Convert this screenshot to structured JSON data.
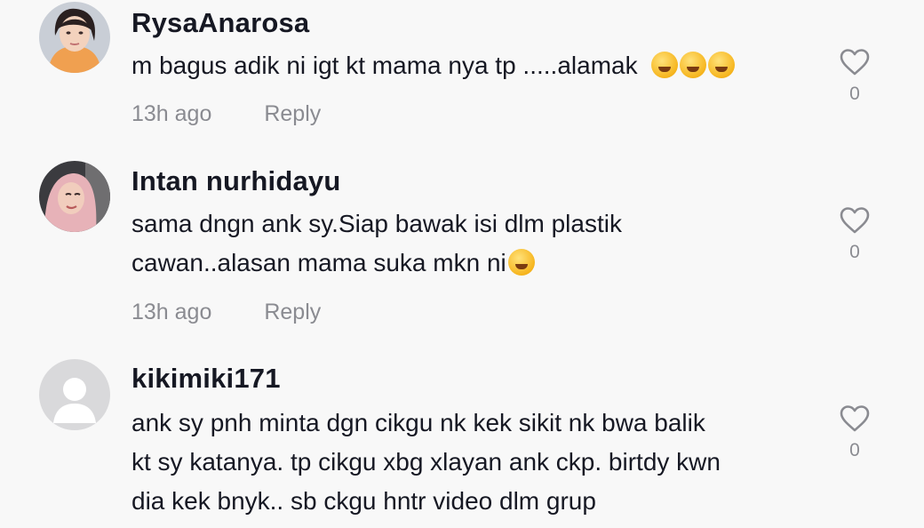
{
  "comments": [
    {
      "username": "RysaAnarosa",
      "lines": [
        "m bagus adik ni igt kt mama nya tp .....alamak"
      ],
      "emojis": [
        "rofl-emoji",
        "rofl-emoji",
        "hand-over-mouth-emoji"
      ],
      "time": "13h ago",
      "reply_label": "Reply",
      "likes": "0",
      "avatar": "woman-photo-avatar"
    },
    {
      "username": "Intan nurhidayu",
      "lines": [
        "sama dngn ank sy.Siap bawak isi dlm plastik",
        "cawan..alasan mama suka mkn ni"
      ],
      "emojis": [
        "joy-emoji"
      ],
      "time": "13h ago",
      "reply_label": "Reply",
      "likes": "0",
      "avatar": "hijab-woman-photo-avatar"
    },
    {
      "username": "kikimiki171",
      "lines": [
        "ank sy pnh minta dgn cikgu nk kek sikit nk bwa balik",
        "kt sy katanya. tp cikgu xbg xlayan ank ckp. birtdy kwn",
        "dia kek bnyk.. sb ckgu hntr video dlm grup"
      ],
      "likes": "0",
      "avatar": "default-avatar"
    }
  ],
  "colors": {
    "background": "#f8f8f8",
    "text": "#161823",
    "muted": "#8a8b91"
  }
}
